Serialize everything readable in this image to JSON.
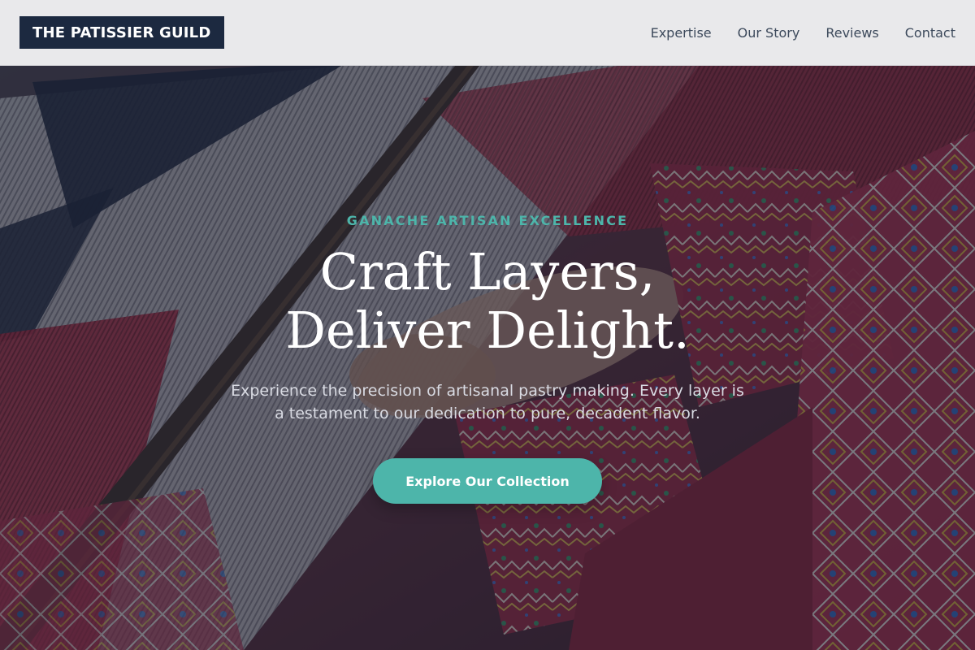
{
  "header": {
    "logo_text": "THE PATISSIER GUILD",
    "nav": [
      {
        "label": "Expertise"
      },
      {
        "label": "Our Story"
      },
      {
        "label": "Reviews"
      },
      {
        "label": "Contact"
      }
    ]
  },
  "hero": {
    "eyebrow": "GANACHE ARTISAN EXCELLENCE",
    "headline_line1": "Craft Layers,",
    "headline_line2": "Deliver Delight.",
    "subtext_line1": "Experience the precision of artisanal pastry making. Every layer is",
    "subtext_line2": "a testament to our dedication to pure, decadent flavor.",
    "cta_label": "Explore Our Collection"
  },
  "colors": {
    "header_bg": "#e9e9eb",
    "logo_bg": "#1c2940",
    "accent": "#4db5aa",
    "nav_text": "#3d4a5c",
    "headline": "#ffffff",
    "subtext": "#d9dbe3"
  }
}
